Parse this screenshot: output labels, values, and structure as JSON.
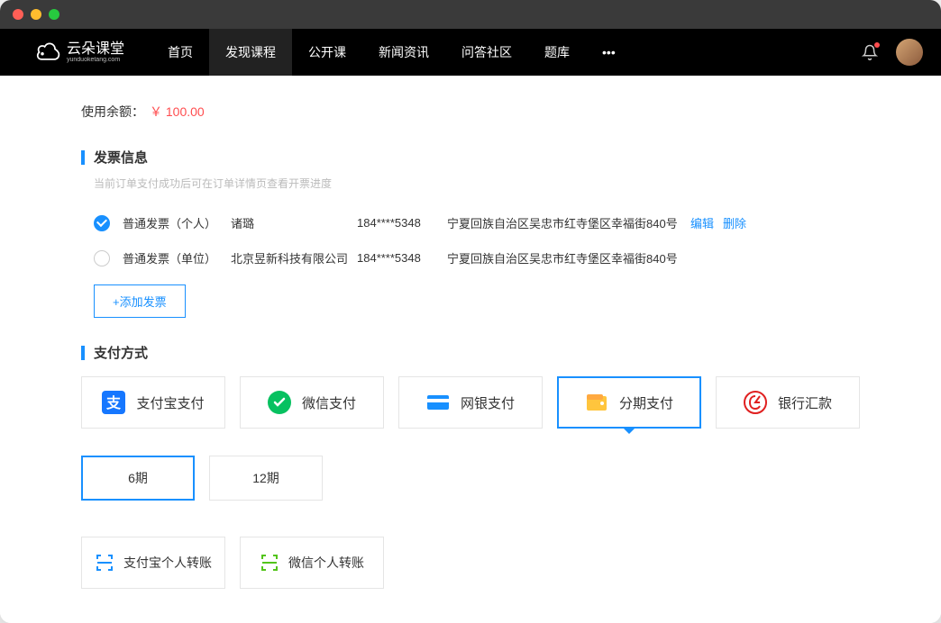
{
  "logo_text": "云朵课堂",
  "logo_sub": "yunduoketang.com",
  "nav": [
    "首页",
    "发现课程",
    "公开课",
    "新闻资讯",
    "问答社区",
    "题库"
  ],
  "nav_active_index": 1,
  "balance": {
    "label": "使用余额：",
    "value": "￥ 100.00"
  },
  "invoice": {
    "title": "发票信息",
    "sub": "当前订单支付成功后可在订单详情页查看开票进度",
    "rows": [
      {
        "type": "普通发票（个人）",
        "name": "诸璐",
        "phone": "184****5348",
        "addr": "宁夏回族自治区吴忠市红寺堡区幸福街840号",
        "checked": true,
        "actions": true
      },
      {
        "type": "普通发票（单位）",
        "name": "北京昱新科技有限公司",
        "phone": "184****5348",
        "addr": "宁夏回族自治区吴忠市红寺堡区幸福街840号",
        "checked": false,
        "actions": false
      }
    ],
    "edit": "编辑",
    "delete": "删除",
    "add": "+添加发票"
  },
  "payment": {
    "title": "支付方式",
    "methods": [
      {
        "key": "alipay",
        "label": "支付宝支付"
      },
      {
        "key": "wechat",
        "label": "微信支付"
      },
      {
        "key": "netbank",
        "label": "网银支付"
      },
      {
        "key": "installment",
        "label": "分期支付"
      },
      {
        "key": "bankwire",
        "label": "银行汇款"
      }
    ],
    "selected": "installment",
    "periods": [
      "6期",
      "12期"
    ],
    "period_selected": 0,
    "transfers": [
      {
        "key": "alipay-transfer",
        "label": "支付宝个人转账"
      },
      {
        "key": "wechat-transfer",
        "label": "微信个人转账"
      }
    ]
  }
}
